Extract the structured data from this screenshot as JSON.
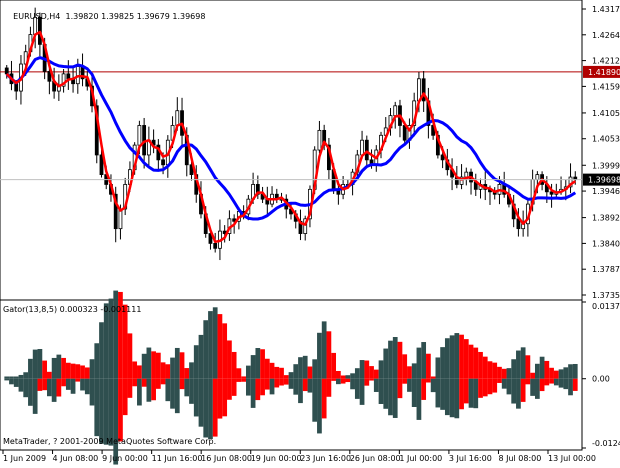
{
  "window": {
    "title": "EURUSD,H4",
    "ohlc": "1.39820 1.39825 1.39679 1.39698"
  },
  "indicator": {
    "label": "Gator(13,8,5) 0.000323 -0.001111"
  },
  "copyright": "MetaTrader, ? 2001-2009 MetaQuotes Software Corp.",
  "colors": {
    "background": "#ffffff",
    "candles": "#000000",
    "fast_line": "#ff0000",
    "slow_line": "#0000ff",
    "level_line": "#b00000",
    "level_box": "#b00000",
    "gator_up": "#2f4f4f",
    "gator_down": "#ff0000",
    "price_box": "#000000"
  },
  "chart_data": [
    {
      "type": "candlestick",
      "symbol": "EURUSD",
      "timeframe": "H4",
      "y_ticks": [
        "1.43170",
        "1.42645",
        "1.42120",
        "1.41595",
        "1.41055",
        "1.40530",
        "1.39990",
        "1.39465",
        "1.38925",
        "1.38400",
        "1.37875",
        "1.37350"
      ],
      "ylim": [
        1.3735,
        1.4317
      ],
      "horizontal_level": 1.4189,
      "horizontal_level_label": "1.41890",
      "current_price": 1.39698,
      "current_price_label": "1.39698",
      "x_ticks": [
        "1 Jun 2009",
        "4 Jun 08:00",
        "9 Jun 00:00",
        "11 Jun 16:00",
        "16 Jun 08:00",
        "19 Jun 00:00",
        "23 Jun 16:00",
        "26 Jun 08:00",
        "1 Jul 00:00",
        "3 Jul 16:00",
        "8 Jul 08:00",
        "13 Jul 00:00"
      ],
      "close": [
        1.4185,
        1.4165,
        1.415,
        1.4205,
        1.423,
        1.4265,
        1.43,
        1.4245,
        1.419,
        1.417,
        1.415,
        1.416,
        1.4185,
        1.4175,
        1.4165,
        1.42,
        1.4175,
        1.416,
        1.412,
        1.402,
        1.398,
        1.396,
        1.394,
        1.387,
        1.391,
        1.396,
        1.399,
        1.404,
        1.408,
        1.402,
        1.405,
        1.404,
        1.401,
        1.4,
        1.405,
        1.408,
        1.411,
        1.406,
        1.4,
        1.398,
        1.394,
        1.39,
        1.386,
        1.384,
        1.383,
        1.3865,
        1.386,
        1.389,
        1.3885,
        1.3905,
        1.39,
        1.393,
        1.396,
        1.394,
        1.393,
        1.392,
        1.394,
        1.393,
        1.393,
        1.391,
        1.39,
        1.3885,
        1.386,
        1.389,
        1.395,
        1.403,
        1.407,
        1.404,
        1.399,
        1.395,
        1.394,
        1.396,
        1.396,
        1.3985,
        1.402,
        1.405,
        1.401,
        1.4,
        1.403,
        1.406,
        1.4075,
        1.41,
        1.412,
        1.408,
        1.405,
        1.408,
        1.413,
        1.4175,
        1.413,
        1.408,
        1.406,
        1.402,
        1.401,
        1.399,
        1.3975,
        1.396,
        1.3975,
        1.3985,
        1.3965,
        1.395,
        1.396,
        1.395,
        1.3945,
        1.394,
        1.396,
        1.394,
        1.392,
        1.389,
        1.387,
        1.388,
        1.392,
        1.397,
        1.398,
        1.396,
        1.3945,
        1.394,
        1.3945,
        1.395,
        1.3955,
        1.3975,
        1.397
      ]
    },
    {
      "type": "histogram",
      "name": "Gator(13,8,5)",
      "y_ticks": [
        "0.013749",
        "0.00",
        "-0.012413"
      ],
      "ylim": [
        -0.012413,
        0.013749
      ],
      "zero_label": "0.00"
    }
  ]
}
